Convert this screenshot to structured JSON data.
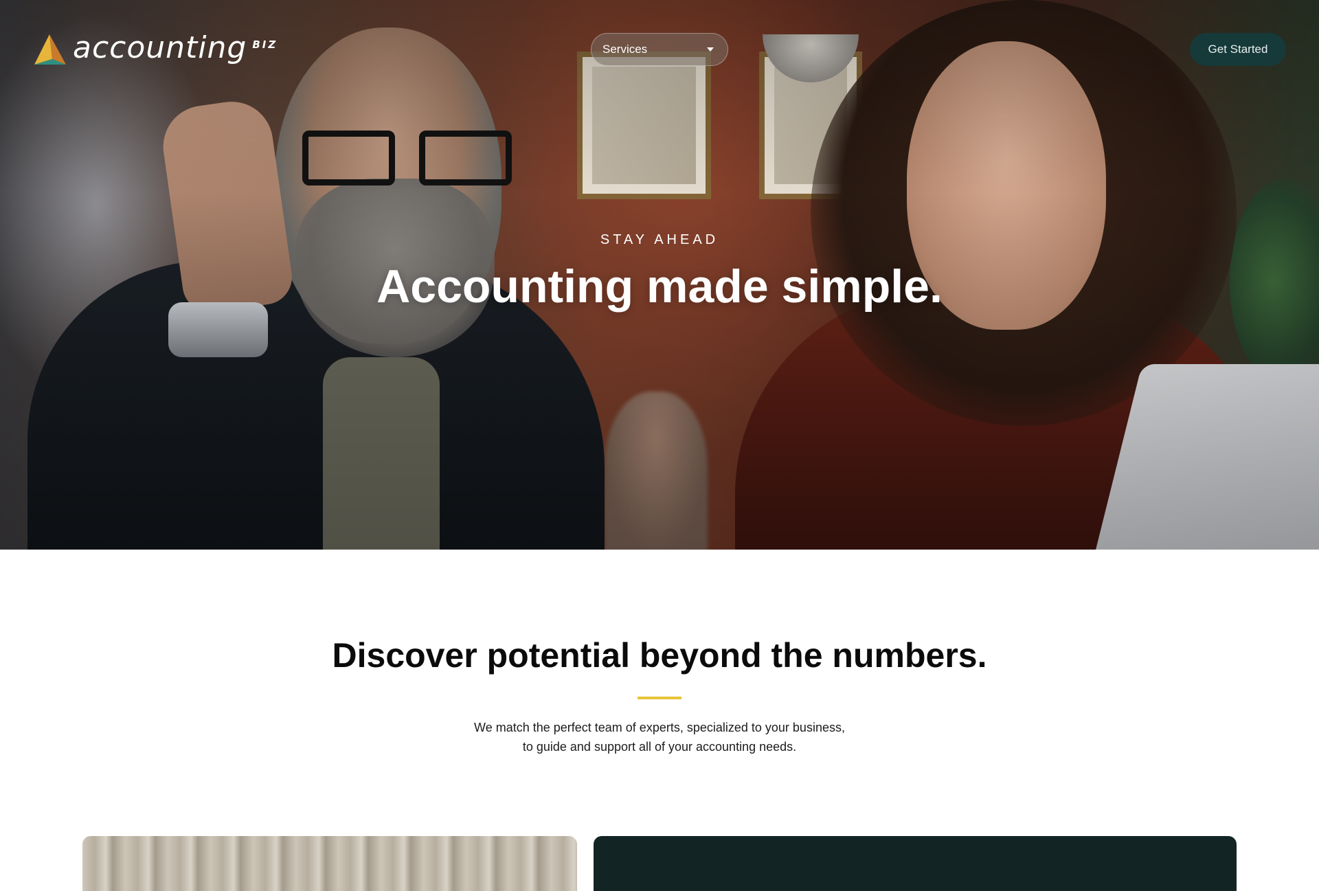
{
  "brand": {
    "name": "accounting",
    "suffix": "BIZ",
    "logo_icon": "triangle-logo-icon"
  },
  "nav": {
    "services_label": "Services",
    "cta_label": "Get Started"
  },
  "hero": {
    "eyebrow": "STAY AHEAD",
    "title": "Accounting made simple."
  },
  "intro": {
    "title": "Discover potential beyond the numbers.",
    "body_lines": [
      "We match the perfect team of experts, specialized to your business,",
      "to guide and support all of your accounting needs."
    ]
  },
  "colors": {
    "accent_yellow": "#e8c43a",
    "cta_bg": "#16393a",
    "dark_card": "#132424"
  }
}
